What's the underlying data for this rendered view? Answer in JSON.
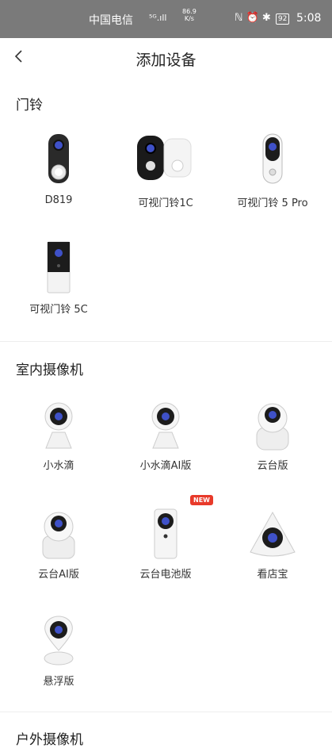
{
  "status_bar": {
    "carrier": "中国电信",
    "signal": "⁵ᴳ.ıll",
    "speed_value": "86.9",
    "speed_unit": "K/s",
    "icons": "ℕ ⏰ ✱",
    "battery": "92",
    "time": "5:08"
  },
  "header": {
    "title": "添加设备",
    "back_icon": "chevron-left-icon"
  },
  "sections": [
    {
      "title": "门铃"
    },
    {
      "title": "室内摄像机"
    },
    {
      "title": "户外摄像机"
    }
  ],
  "devices": [
    {
      "label": "D819"
    },
    {
      "label": "可视门铃1C"
    },
    {
      "label": "可视门铃 5 Pro"
    },
    {
      "label": "可视门铃 5C"
    },
    {
      "label": "小水滴"
    },
    {
      "label": "小水滴AI版"
    },
    {
      "label": "云台版"
    },
    {
      "label": "云台AI版"
    },
    {
      "label": "云台电池版",
      "badge": "NEW"
    },
    {
      "label": "看店宝"
    },
    {
      "label": "悬浮版"
    }
  ],
  "colors": {
    "badge": "#e83a2a",
    "status_bar": "#7a7a7a",
    "lens": "#3f51c8"
  }
}
